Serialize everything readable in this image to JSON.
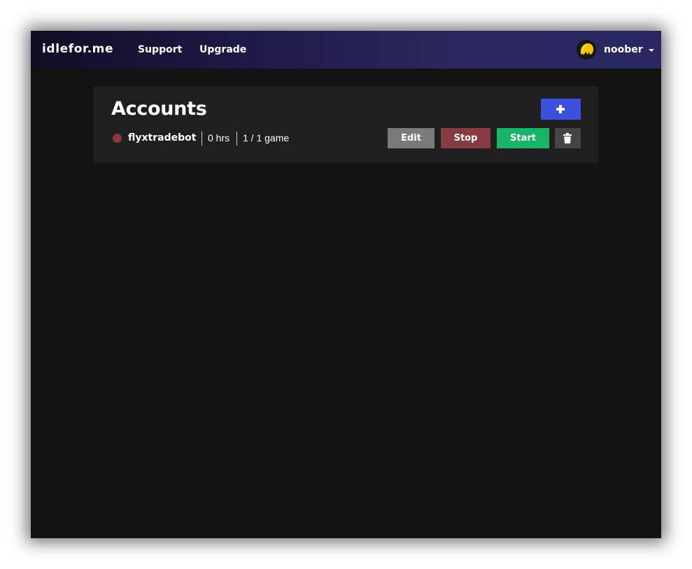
{
  "navbar": {
    "brand": "idlefor.me",
    "links": [
      {
        "label": "Support"
      },
      {
        "label": "Upgrade"
      }
    ],
    "user": {
      "name": "noober",
      "avatar_icon": "yellow-character-avatar"
    }
  },
  "accounts": {
    "title": "Accounts",
    "add_icon": "plus-icon",
    "rows": [
      {
        "name": "flyxtradebot",
        "status_color": "#8c3a3e",
        "hours": "0 hrs",
        "games": "1 / 1 game",
        "actions": {
          "edit": "Edit",
          "stop": "Stop",
          "start": "Start",
          "delete_icon": "trash-icon"
        }
      }
    ]
  },
  "colors": {
    "background": "#131313",
    "card": "#1f1f1f",
    "add_button": "#3c50e0",
    "edit_button": "#7a7a7a",
    "stop_button": "#853b3f",
    "start_button": "#18b468",
    "delete_button": "#454545"
  }
}
